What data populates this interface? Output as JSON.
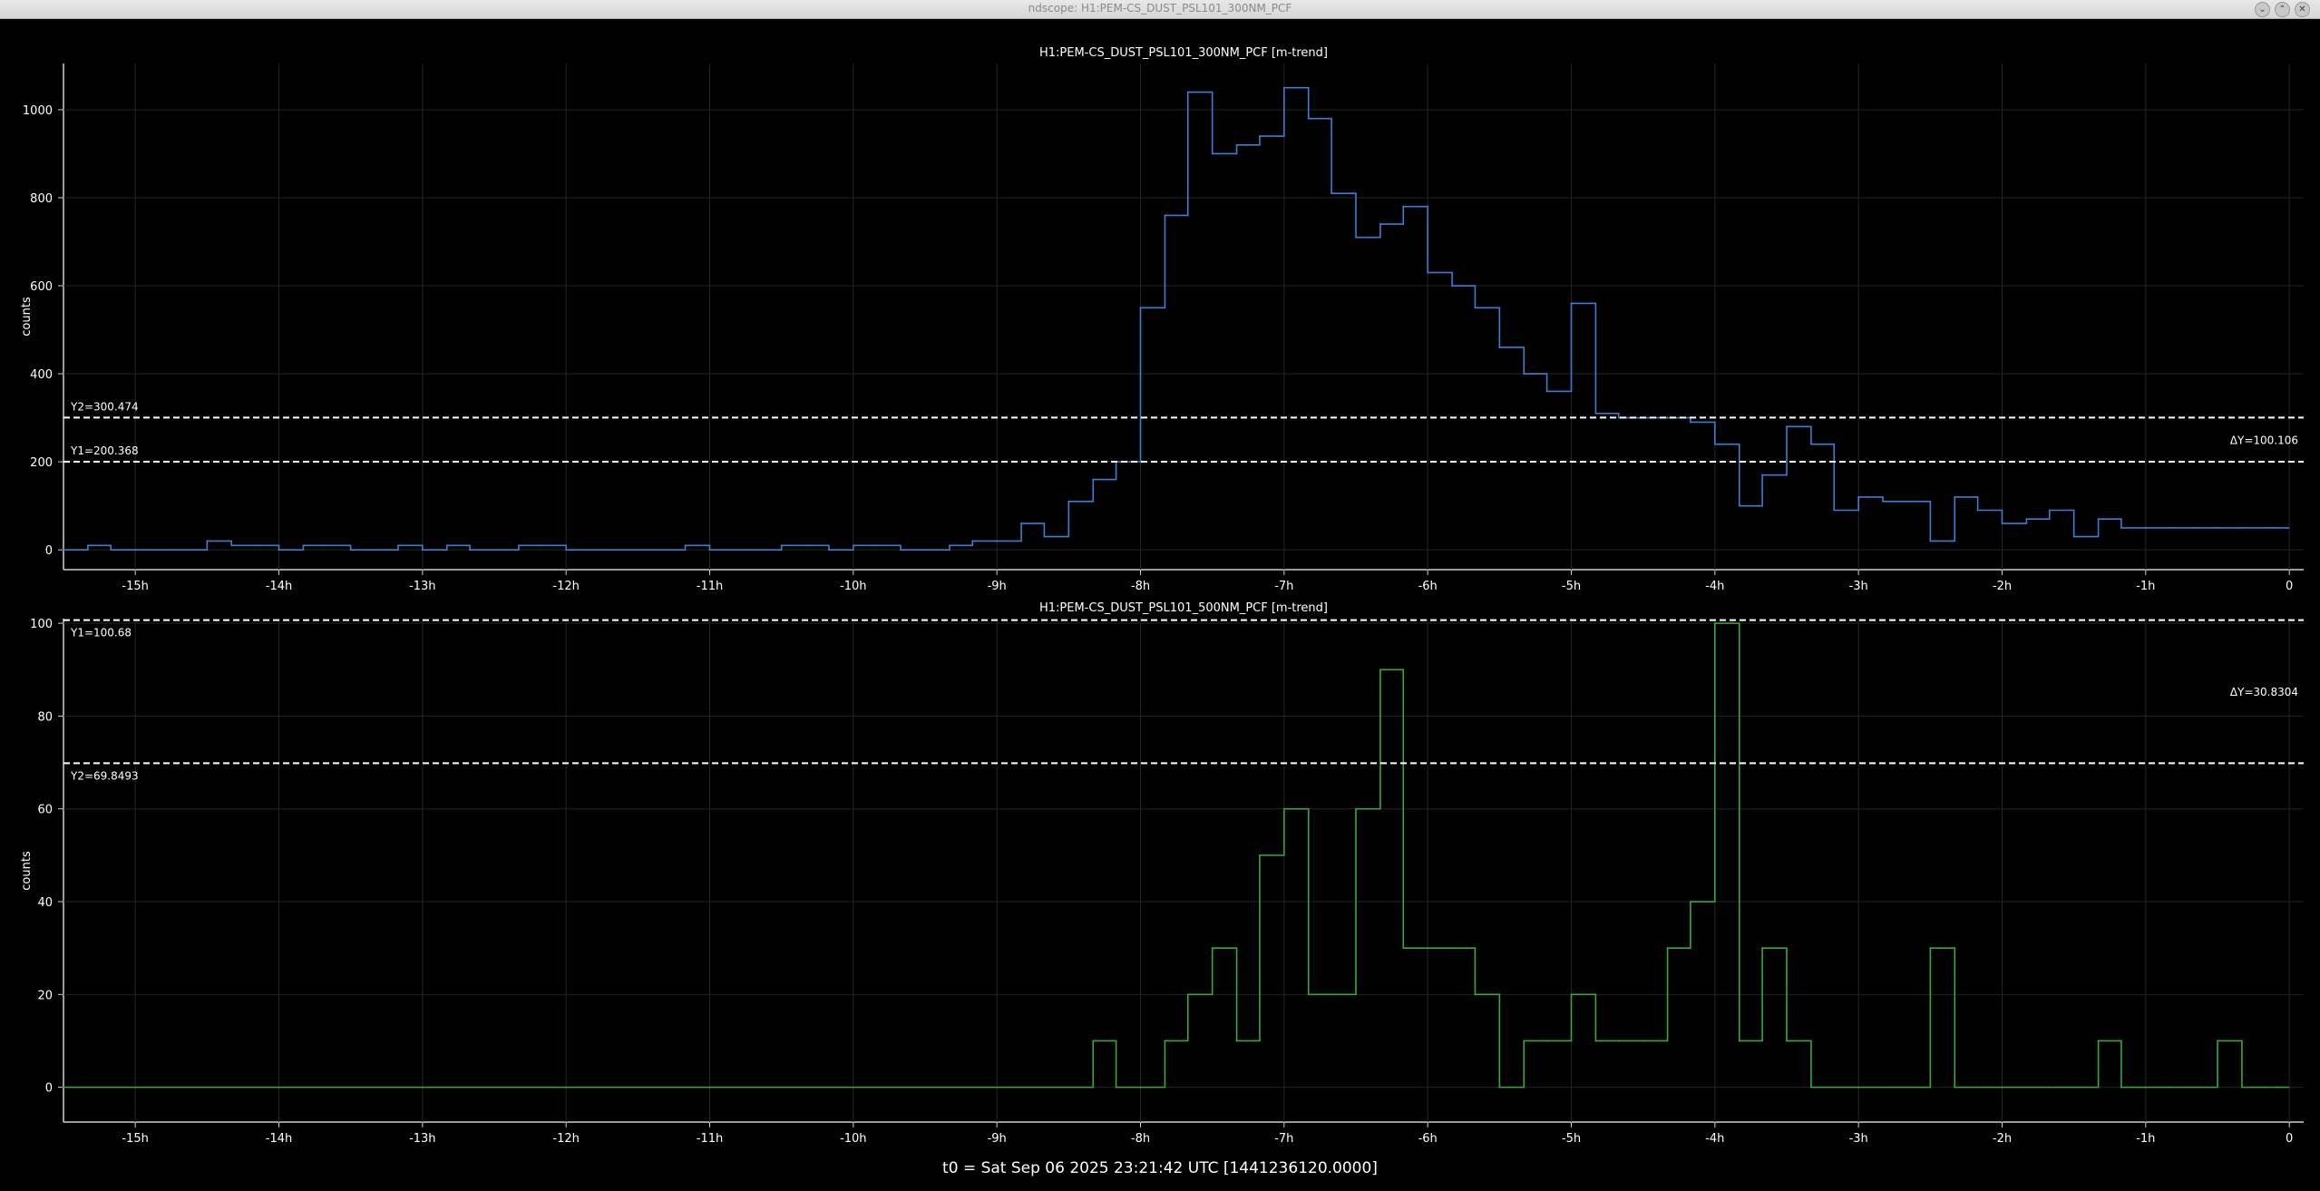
{
  "window": {
    "title": "ndscope: H1:PEM-CS_DUST_PSL101_300NM_PCF",
    "buttons": [
      "⌄",
      "⌃",
      "✕"
    ]
  },
  "footer": {
    "t0": "t0 = Sat Sep 06 2025 23:21:42 UTC [1441236120.0000]"
  },
  "chart_data": [
    {
      "type": "line",
      "title": "H1:PEM-CS_DUST_PSL101_300NM_PCF [m-trend]",
      "ylabel": "counts",
      "xlabel": "",
      "x_ticks": [
        "-15h",
        "-14h",
        "-13h",
        "-12h",
        "-11h",
        "-10h",
        "-9h",
        "-8h",
        "-7h",
        "-6h",
        "-5h",
        "-4h",
        "-3h",
        "-2h",
        "-1h",
        "0"
      ],
      "y_ticks": [
        0,
        200,
        400,
        600,
        800,
        1000
      ],
      "xlim": [
        -15.5,
        0.1
      ],
      "ylim": [
        -45,
        1105
      ],
      "grid": true,
      "line_color": "#3a7fd5",
      "cursors": {
        "Y1": 200.368,
        "Y2": 300.474,
        "y1_label": "Y1=200.368",
        "y2_label": "Y2=300.474",
        "delta_label": "ΔY=100.106"
      },
      "series": [
        {
          "x": [
            -15.5,
            -15.33,
            -15.17,
            -15.0,
            -14.83,
            -14.67,
            -14.5,
            -14.33,
            -14.17,
            -14.0,
            -13.83,
            -13.67,
            -13.5,
            -13.33,
            -13.17,
            -13.0,
            -12.83,
            -12.67,
            -12.5,
            -12.33,
            -12.17,
            -12.0,
            -11.83,
            -11.67,
            -11.5,
            -11.33,
            -11.17,
            -11.0,
            -10.83,
            -10.67,
            -10.5,
            -10.33,
            -10.17,
            -10.0,
            -9.83,
            -9.67,
            -9.5,
            -9.33,
            -9.17,
            -9.0,
            -8.83,
            -8.67,
            -8.5,
            -8.33,
            -8.17,
            -8.0,
            -7.83,
            -7.67,
            -7.5,
            -7.33,
            -7.17,
            -7.0,
            -6.83,
            -6.67,
            -6.5,
            -6.33,
            -6.17,
            -6.0,
            -5.83,
            -5.67,
            -5.5,
            -5.33,
            -5.17,
            -5.0,
            -4.83,
            -4.67,
            -4.5,
            -4.33,
            -4.17,
            -4.0,
            -3.83,
            -3.67,
            -3.5,
            -3.33,
            -3.17,
            -3.0,
            -2.83,
            -2.67,
            -2.5,
            -2.33,
            -2.17,
            -2.0,
            -1.83,
            -1.67,
            -1.5,
            -1.33,
            -1.17,
            -1.0,
            -0.83,
            -0.67,
            -0.5,
            -0.33,
            -0.17,
            -0.08
          ],
          "y": [
            0,
            10,
            0,
            0,
            0,
            0,
            20,
            10,
            10,
            0,
            10,
            10,
            0,
            0,
            10,
            0,
            10,
            0,
            0,
            10,
            10,
            0,
            0,
            0,
            0,
            0,
            10,
            0,
            0,
            0,
            10,
            10,
            0,
            10,
            10,
            0,
            0,
            10,
            20,
            20,
            60,
            30,
            110,
            160,
            200,
            550,
            760,
            1040,
            900,
            920,
            940,
            1050,
            980,
            810,
            710,
            740,
            780,
            630,
            600,
            550,
            460,
            400,
            360,
            560,
            310,
            300,
            300,
            300,
            290,
            240,
            100,
            170,
            280,
            240,
            90,
            120,
            110,
            110,
            20,
            120,
            90,
            60,
            70,
            90,
            30,
            70,
            50,
            50,
            50,
            50,
            50,
            50,
            50,
            50
          ]
        }
      ]
    },
    {
      "type": "line",
      "title": "H1:PEM-CS_DUST_PSL101_500NM_PCF [m-trend]",
      "ylabel": "counts",
      "xlabel": "",
      "x_ticks": [
        "-15h",
        "-14h",
        "-13h",
        "-12h",
        "-11h",
        "-10h",
        "-9h",
        "-8h",
        "-7h",
        "-6h",
        "-5h",
        "-4h",
        "-3h",
        "-2h",
        "-1h",
        "0"
      ],
      "y_ticks": [
        0,
        20,
        40,
        60,
        80,
        100
      ],
      "xlim": [
        -15.5,
        0.1
      ],
      "ylim": [
        -7.5,
        101
      ],
      "grid": true,
      "line_color": "#3aa83a",
      "cursors": {
        "Y1": 100.68,
        "Y2": 69.8493,
        "y1_label": "Y1=100.68",
        "y2_label": "Y2=69.8493",
        "delta_label": "ΔY=30.8304"
      },
      "series": [
        {
          "x": [
            -15.5,
            -8.33,
            -8.17,
            -8.0,
            -7.83,
            -7.67,
            -7.5,
            -7.33,
            -7.17,
            -7.0,
            -6.83,
            -6.67,
            -6.5,
            -6.33,
            -6.17,
            -6.0,
            -5.83,
            -5.67,
            -5.5,
            -5.33,
            -5.17,
            -5.0,
            -4.83,
            -4.67,
            -4.5,
            -4.33,
            -4.17,
            -4.0,
            -3.83,
            -3.67,
            -3.5,
            -3.33,
            -3.17,
            -3.0,
            -2.83,
            -2.67,
            -2.5,
            -2.33,
            -2.17,
            -2.0,
            -1.83,
            -1.67,
            -1.5,
            -1.33,
            -1.17,
            -1.0,
            -0.83,
            -0.67,
            -0.5,
            -0.33,
            -0.17,
            -0.08
          ],
          "y": [
            0,
            10,
            0,
            0,
            10,
            20,
            30,
            10,
            50,
            60,
            20,
            20,
            60,
            90,
            30,
            30,
            30,
            20,
            0,
            10,
            10,
            20,
            10,
            10,
            10,
            30,
            40,
            100,
            10,
            30,
            10,
            0,
            0,
            0,
            0,
            0,
            30,
            0,
            0,
            0,
            0,
            0,
            0,
            10,
            0,
            0,
            0,
            0,
            10,
            0,
            0,
            0
          ]
        }
      ]
    }
  ]
}
